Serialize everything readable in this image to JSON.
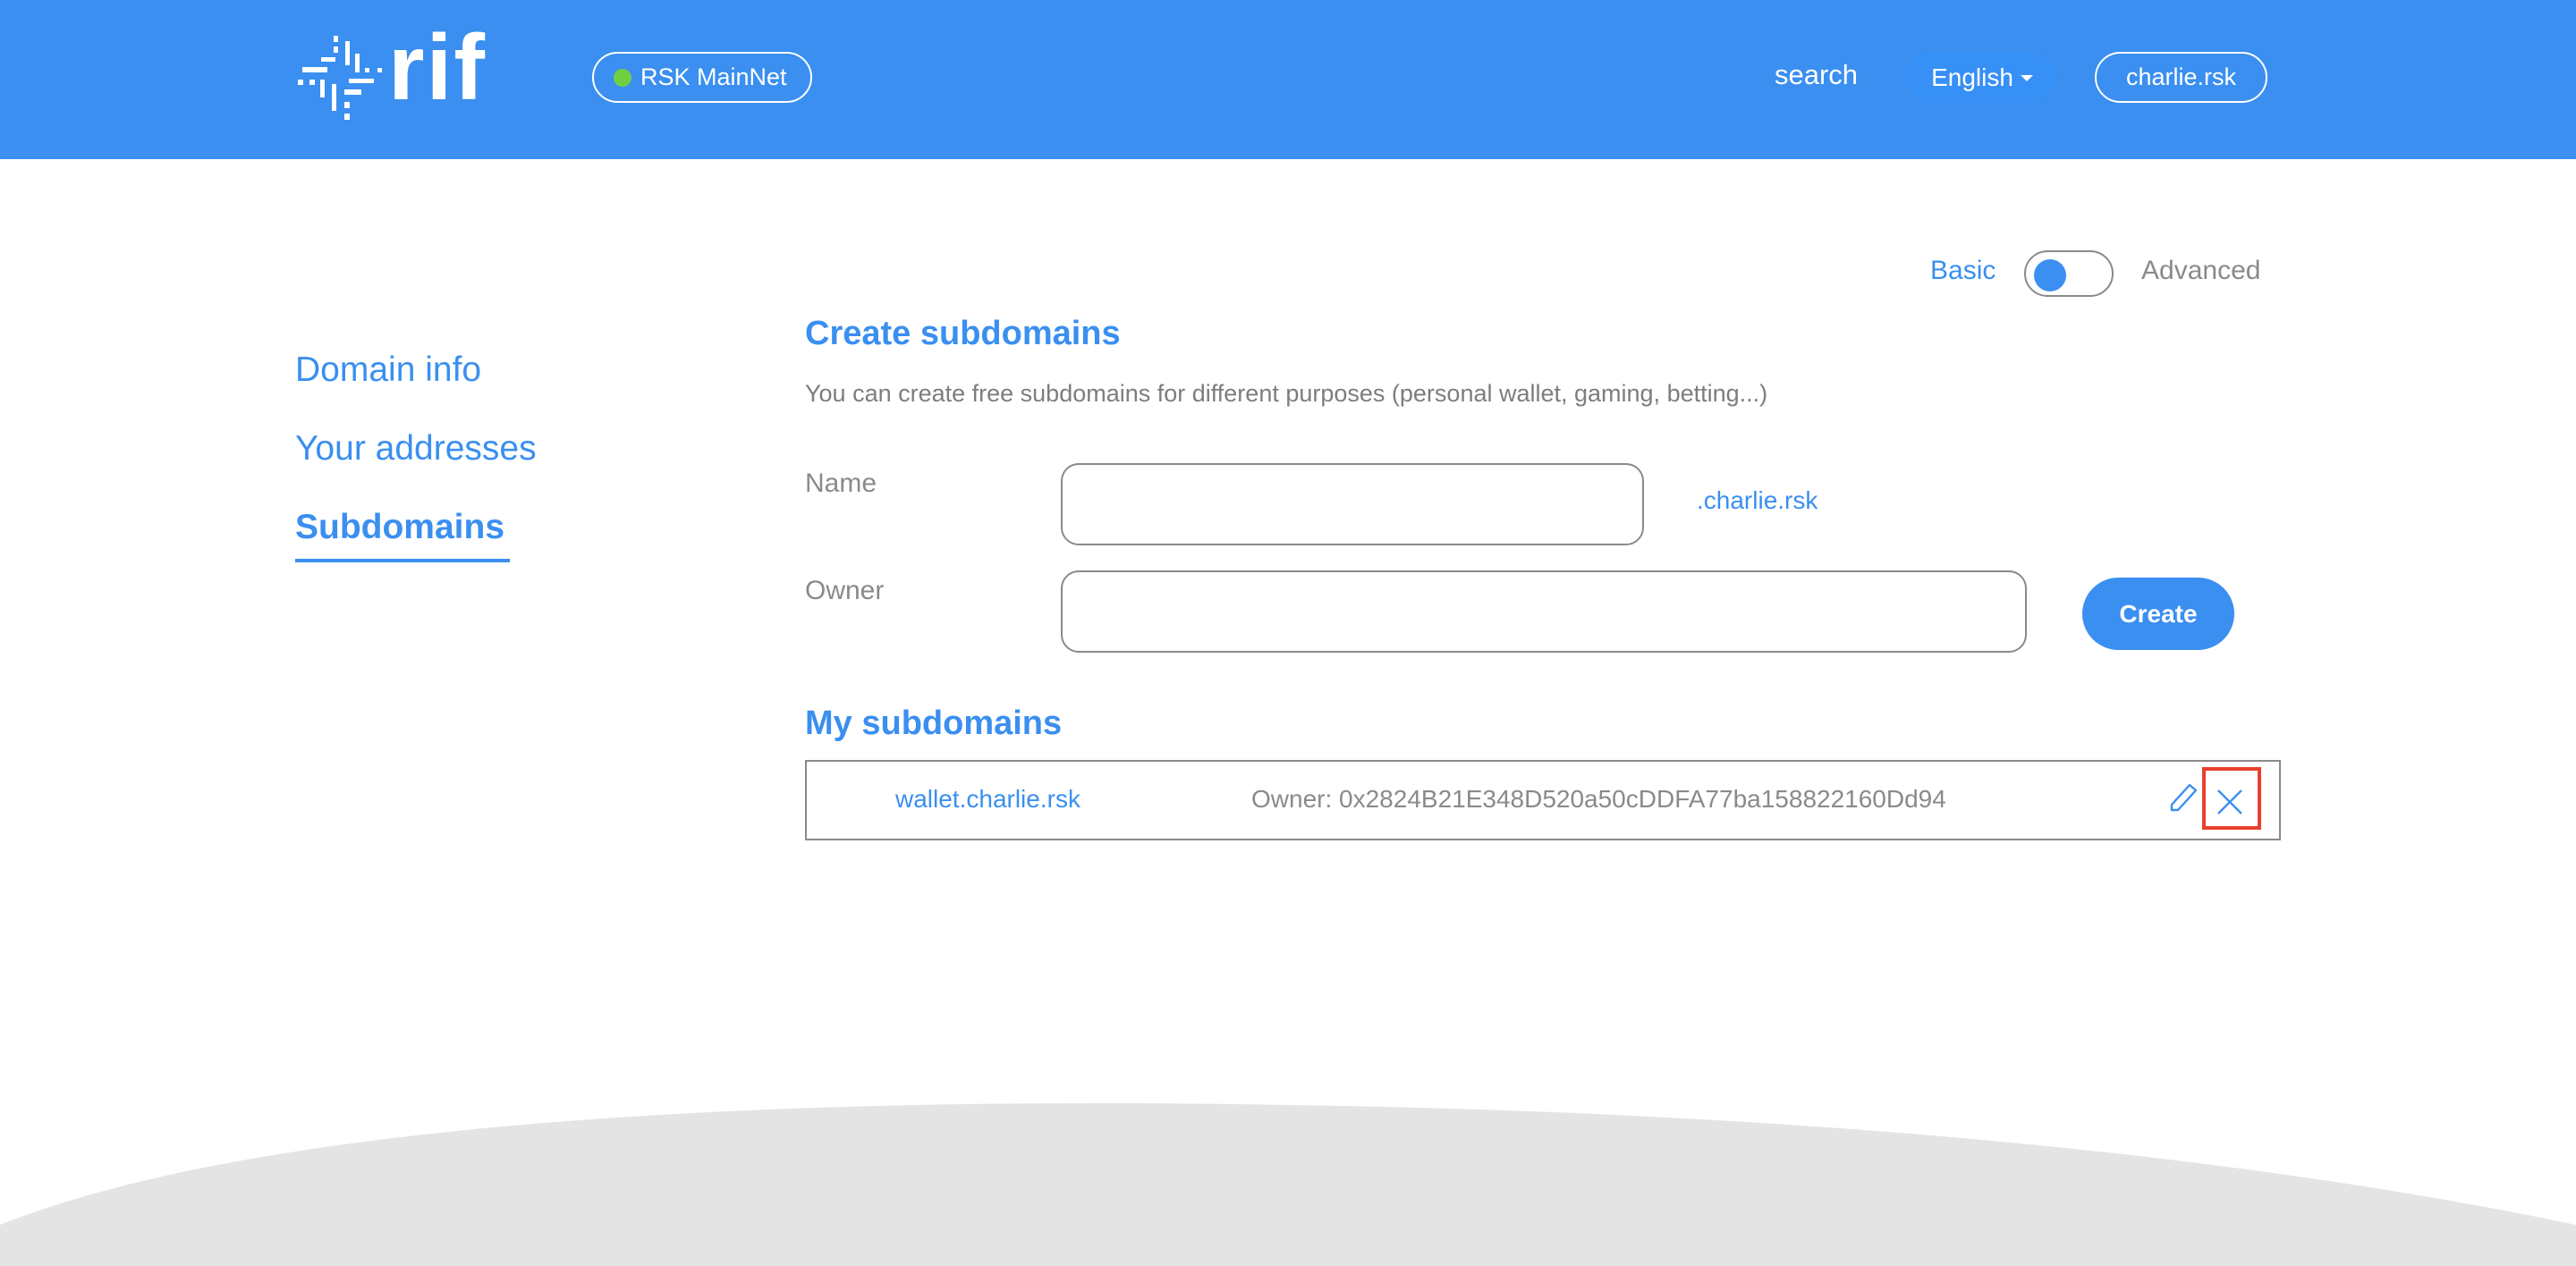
{
  "header": {
    "logo_text": "rif",
    "network": {
      "label": "RSK MainNet",
      "status_color": "#6fcf42"
    },
    "nav": {
      "search_label": "search",
      "language": {
        "selected": "English"
      },
      "account_label": "charlie.rsk"
    },
    "brand_color": "#3a8ff0"
  },
  "mode_toggle": {
    "left_label": "Basic",
    "right_label": "Advanced",
    "selected": "Basic"
  },
  "sidebar": {
    "items": [
      {
        "label": "Domain info",
        "active": false
      },
      {
        "label": "Your addresses",
        "active": false
      },
      {
        "label": "Subdomains",
        "active": true
      }
    ]
  },
  "create_section": {
    "title": "Create subdomains",
    "description": "You can create free subdomains for different purposes (personal wallet, gaming, betting...)",
    "name_label": "Name",
    "name_value": "",
    "name_suffix": ".charlie.rsk",
    "owner_label": "Owner",
    "owner_value": "",
    "create_button": "Create"
  },
  "my_subdomains": {
    "title": "My subdomains",
    "items": [
      {
        "name": "wallet.charlie.rsk",
        "owner_text": "Owner: 0x2824B21E348D520a50cDDFA77ba158822160Dd94",
        "actions": [
          "edit-icon",
          "close-icon"
        ]
      }
    ]
  },
  "highlight": {
    "target": "delete-subdomain-button",
    "color": "#e8412c"
  }
}
